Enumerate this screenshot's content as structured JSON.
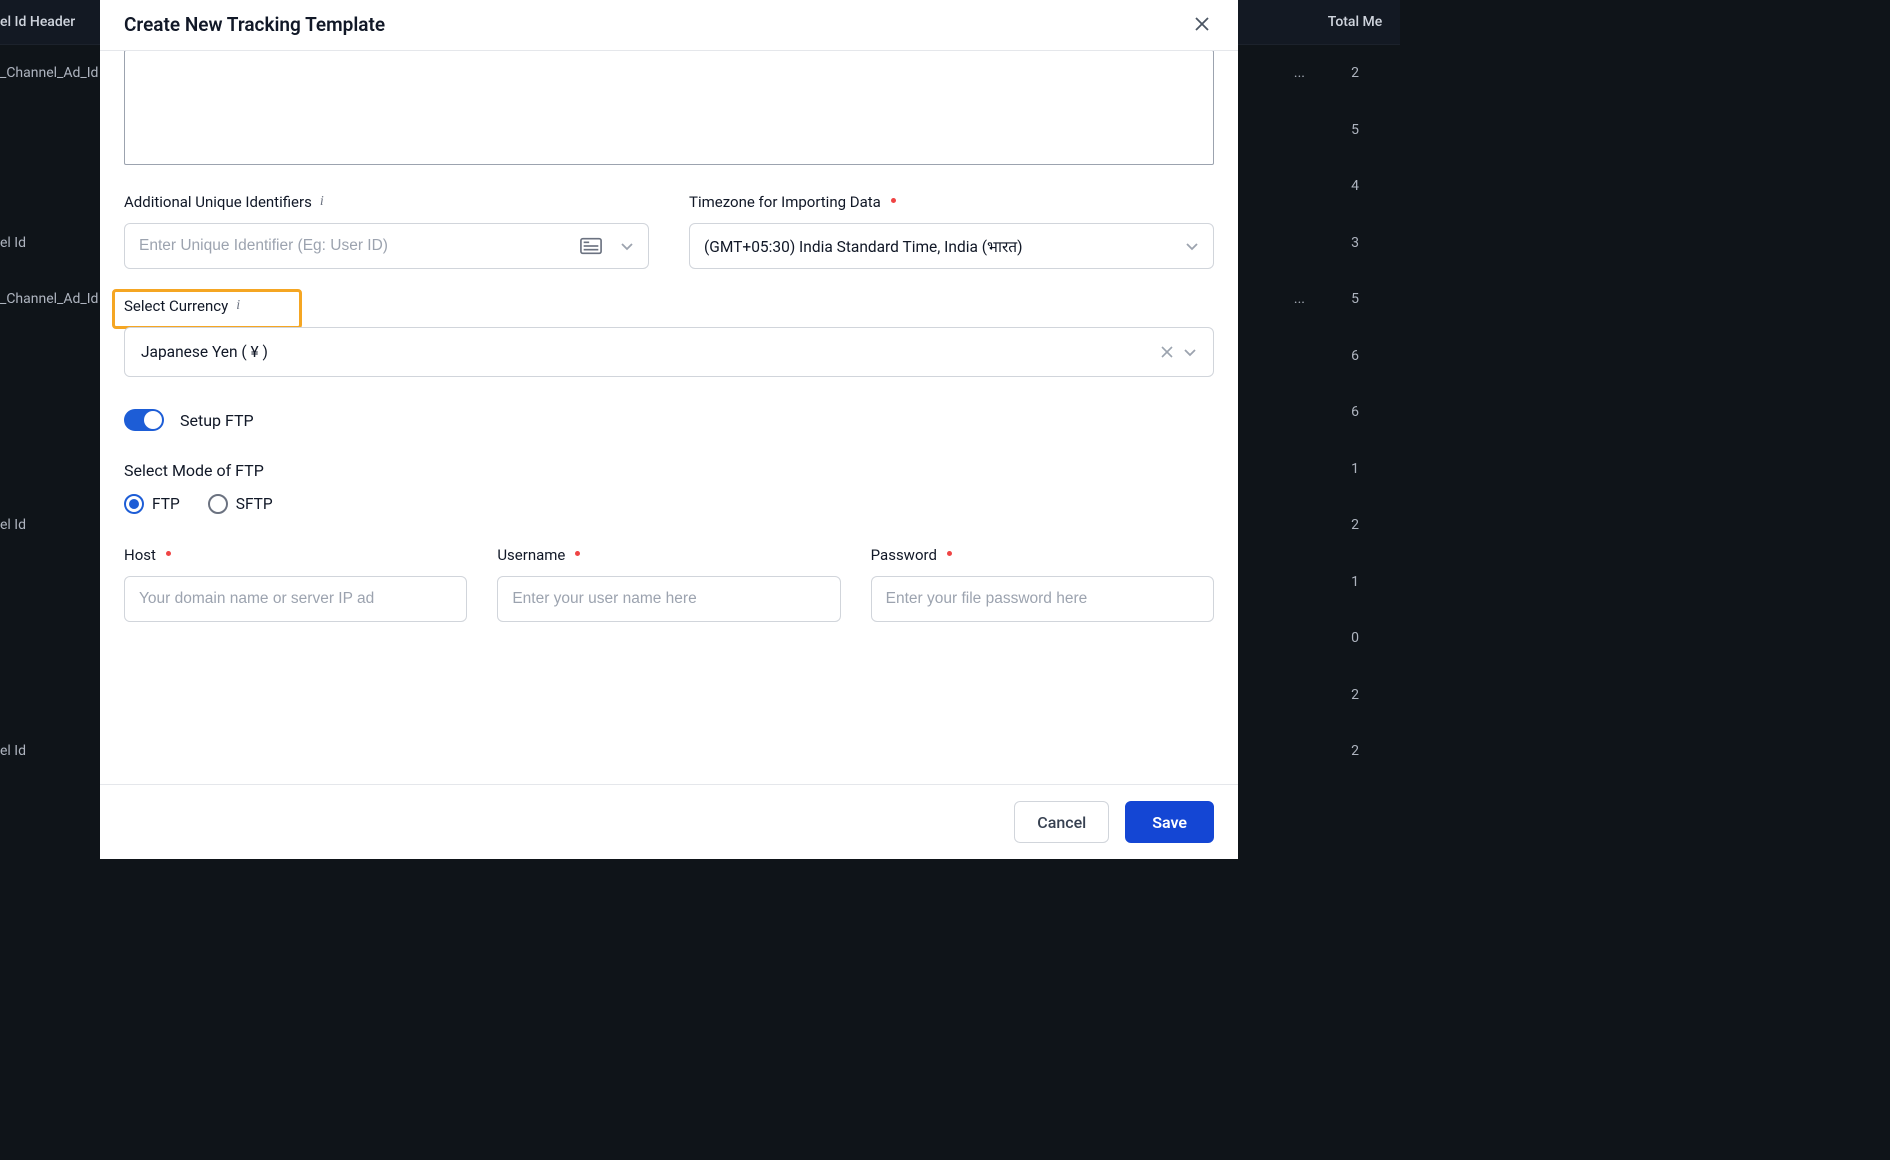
{
  "background": {
    "header_left": "el Id Header",
    "header_right": "Total Me",
    "rows": [
      {
        "left": "_Channel_Ad_Id",
        "right_suffix": "...",
        "count": "2"
      },
      {
        "left": "",
        "count": "5"
      },
      {
        "left": "",
        "count": "4"
      },
      {
        "left": "el Id",
        "count": "3"
      },
      {
        "left": "_Channel_Ad_Id",
        "right_suffix": "...",
        "count": "5"
      },
      {
        "left": "",
        "count": "6"
      },
      {
        "left": "",
        "count": "6"
      },
      {
        "left": "",
        "count": "1"
      },
      {
        "left": "el Id",
        "count": "2"
      },
      {
        "left": "",
        "count": "1"
      },
      {
        "left": "",
        "count": "0"
      },
      {
        "left": "",
        "count": "2"
      },
      {
        "left": "el Id",
        "count": "2"
      }
    ]
  },
  "modal": {
    "title": "Create New Tracking Template",
    "labels": {
      "additional_ids": "Additional Unique Identifiers",
      "timezone": "Timezone for Importing Data",
      "currency": "Select Currency",
      "setup_ftp": "Setup FTP",
      "mode_ftp": "Select Mode of FTP",
      "host": "Host",
      "username": "Username",
      "password": "Password"
    },
    "placeholders": {
      "unique_id": "Enter Unique Identifier (Eg: User ID)",
      "host": "Your domain name or server IP ad",
      "username": "Enter your user name here",
      "password": "Enter your file password here"
    },
    "values": {
      "timezone": "(GMT+05:30) India Standard Time, India (भारत)",
      "currency": "Japanese Yen ( ¥ )"
    },
    "radios": {
      "ftp": "FTP",
      "sftp": "SFTP",
      "selected": "ftp"
    },
    "footer": {
      "cancel": "Cancel",
      "save": "Save"
    }
  }
}
